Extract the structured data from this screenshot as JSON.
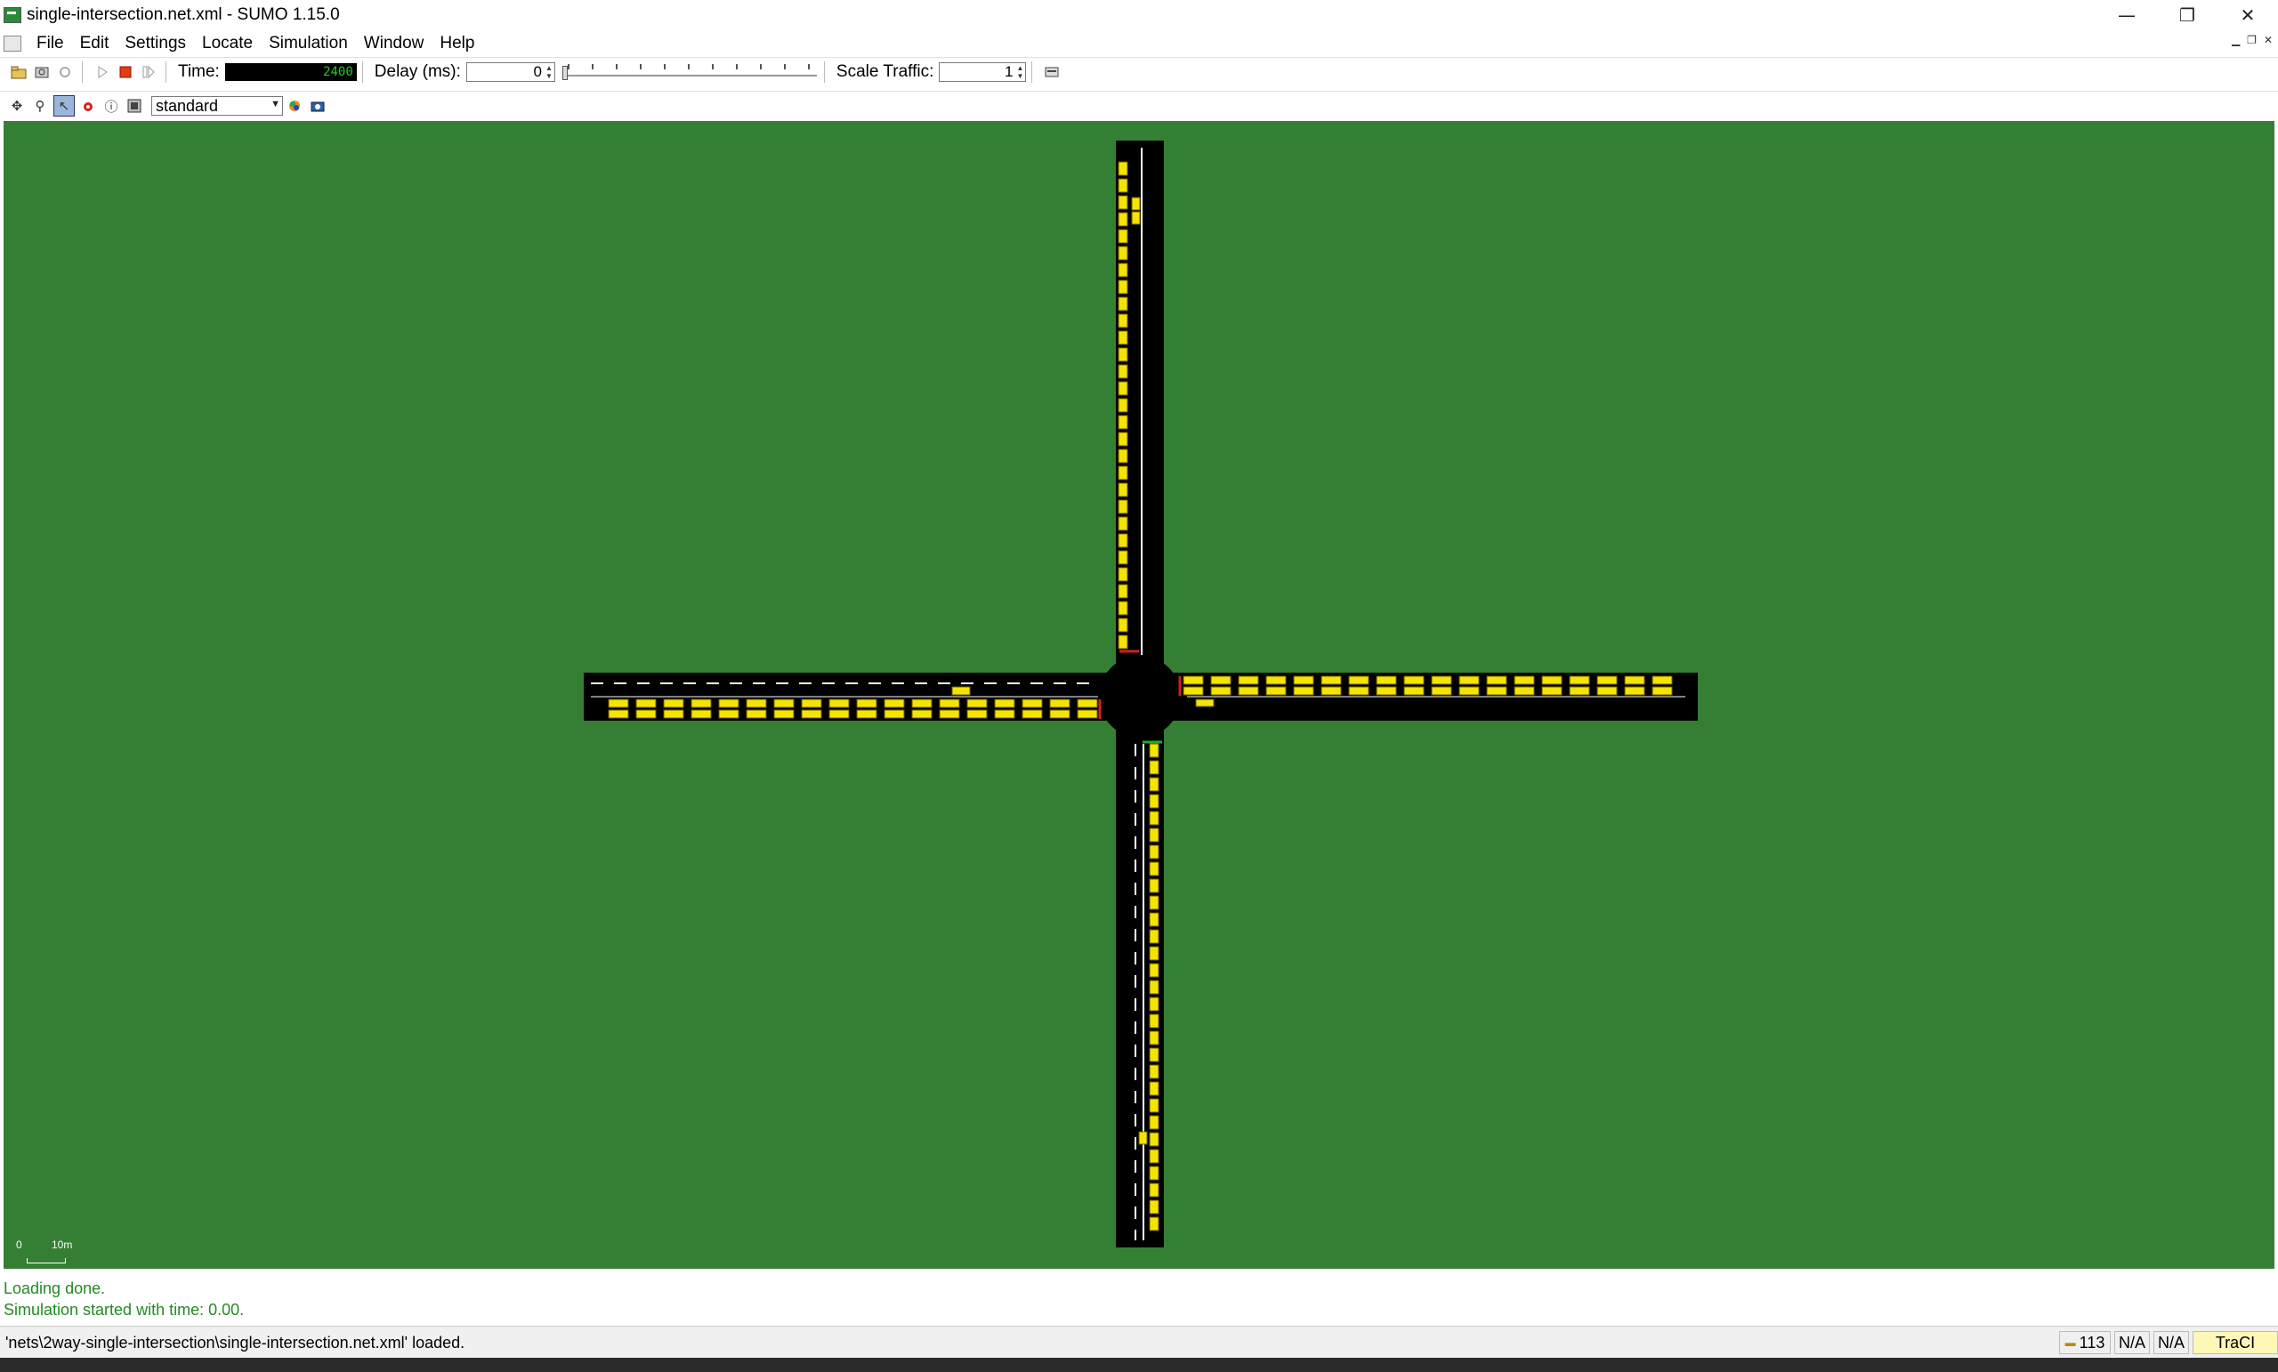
{
  "window": {
    "title": "single-intersection.net.xml - SUMO 1.15.0",
    "minimize": "—",
    "restore": "❐",
    "close": "✕"
  },
  "menu": {
    "items": [
      {
        "label": "File"
      },
      {
        "label": "Edit"
      },
      {
        "label": "Settings"
      },
      {
        "label": "Locate"
      },
      {
        "label": "Simulation"
      },
      {
        "label": "Window"
      },
      {
        "label": "Help"
      }
    ]
  },
  "toolbar": {
    "time_label": "Time:",
    "time_value": "2400",
    "delay_label": "Delay (ms):",
    "delay_value": "0",
    "scale_traffic_label": "Scale Traffic:",
    "scale_traffic_value": "1"
  },
  "view_toolbar": {
    "scheme": "standard"
  },
  "canvas": {
    "background_color": "#357f35",
    "road_color": "#000000",
    "vehicle_color": "#f5e400",
    "scale_zero": "0",
    "scale_label": "10m"
  },
  "messages": {
    "line1": "Loading done.",
    "line2": "Simulation started with time: 0.00."
  },
  "status": {
    "text": "'nets\\2way-single-intersection\\single-intersection.net.xml' loaded.",
    "vehicle_count": "113",
    "coord1": "N/A",
    "coord2": "N/A",
    "traci": "TraCI"
  }
}
